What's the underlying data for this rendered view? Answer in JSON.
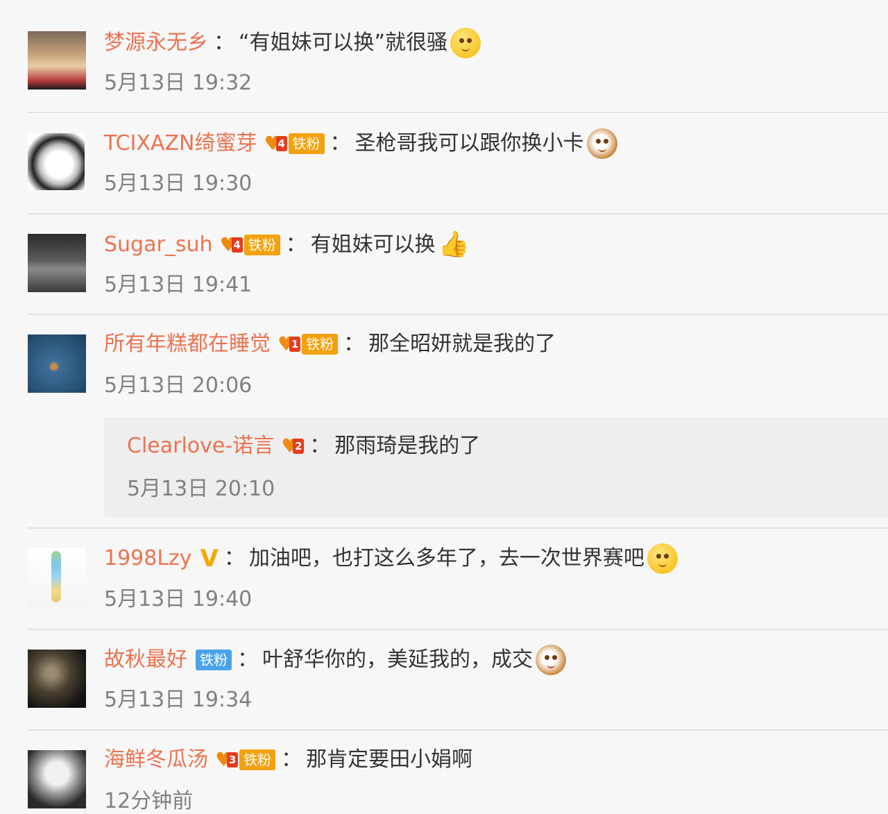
{
  "comments": [
    {
      "user": "梦源永无乡",
      "badge": null,
      "text": "“有姐妹可以换”就很骚",
      "emoji": "dog-face-emoji",
      "time": "5月13日 19:32"
    },
    {
      "user": "TCIXAZN绮蜜芽",
      "badge": {
        "level": "4",
        "label": "铁粉",
        "color": "#f2a20f"
      },
      "text": "圣枪哥我可以跟你换小卡",
      "emoji": "cat-face-emoji",
      "time": "5月13日 19:30"
    },
    {
      "user": "Sugar_suh",
      "badge": {
        "level": "4",
        "label": "铁粉",
        "color": "#f2a20f"
      },
      "text": "有姐妹可以换",
      "emoji": "thumbs-up-emoji",
      "time": "5月13日 19:41"
    },
    {
      "user": "所有年糕都在睡觉",
      "badge": {
        "level": "1",
        "label": "铁粉",
        "color": "#f2a20f"
      },
      "text": "那全昭妍就是我的了",
      "emoji": null,
      "time": "5月13日 20:06",
      "reply": {
        "user": "Clearlove-诺言",
        "badge": {
          "level": "2"
        },
        "text": "那雨琦是我的了",
        "time": "5月13日 20:10"
      }
    },
    {
      "user": "1998Lzy",
      "badge": {
        "verified": "V"
      },
      "text": "加油吧，也打这么多年了，去一次世界赛吧",
      "emoji": "blush-face-emoji",
      "time": "5月13日 19:40"
    },
    {
      "user": "故秋最好",
      "badge": {
        "label": "铁粉",
        "color": "#4aa3ea"
      },
      "text": "叶舒华你的，美延我的，成交",
      "emoji": "cat-face-emoji",
      "time": "5月13日 19:34"
    },
    {
      "user": "海鲜冬瓜汤",
      "badge": {
        "level": "3",
        "label": "铁粉",
        "color": "#f2a20f"
      },
      "text": "那肯定要田小娟啊",
      "emoji": null,
      "time": "12分钟前"
    }
  ],
  "colon": "："
}
